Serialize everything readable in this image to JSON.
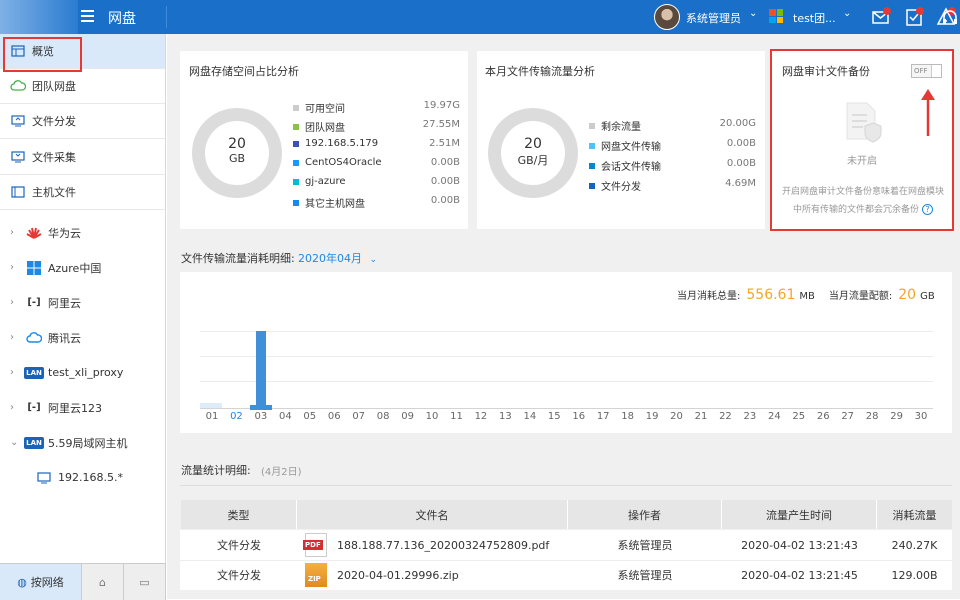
{
  "header": {
    "app_title": "网盘",
    "user_name": "系统管理员",
    "org_name": "test团...",
    "icons": [
      "menu-icon",
      "message-icon",
      "approval-icon",
      "alarm-icon",
      "headset-icon"
    ]
  },
  "sidebar": {
    "items": [
      {
        "label": "概览",
        "icon": "overview-icon"
      },
      {
        "label": "团队网盘",
        "icon": "cloud-icon"
      },
      {
        "label": "文件分发",
        "icon": "distribute-icon"
      },
      {
        "label": "文件采集",
        "icon": "collect-icon"
      },
      {
        "label": "主机文件",
        "icon": "host-icon"
      },
      {
        "label": "华为云",
        "icon": "huawei-icon"
      },
      {
        "label": "Azure中国",
        "icon": "windows-icon"
      },
      {
        "label": "阿里云",
        "icon": "aliyun-icon"
      },
      {
        "label": "腾讯云",
        "icon": "tencent-icon"
      },
      {
        "label": "test_xli_proxy",
        "icon": "lan-icon"
      },
      {
        "label": "阿里云123",
        "icon": "aliyun-icon"
      },
      {
        "label": "5.59局域网主机",
        "icon": "lan-icon"
      },
      {
        "label": "192.168.5.*",
        "icon": "monitor-icon"
      }
    ],
    "lan_badge": "LAN",
    "bottom_tabs": [
      {
        "label": "按网络",
        "icon": "globe-icon"
      },
      {
        "label": "",
        "icon": "tag-icon"
      },
      {
        "label": "",
        "icon": "folder-icon"
      }
    ]
  },
  "storage_card": {
    "title": "网盘存储空间占比分析",
    "center_value": "20",
    "center_unit": "GB",
    "legend": [
      {
        "label": "可用空间",
        "value": "19.97G",
        "color": "#cccccc"
      },
      {
        "label": "团队网盘",
        "value": "27.55M",
        "color": "#8bc34a"
      },
      {
        "label": "192.168.5.179",
        "value": "2.51M",
        "color": "#3f51b5"
      },
      {
        "label": "CentOS4Oracle",
        "value": "0.00B",
        "color": "#2196f3"
      },
      {
        "label": "gj-azure",
        "value": "0.00B",
        "color": "#00bcd4"
      },
      {
        "label": "其它主机网盘",
        "value": "0.00B",
        "color": "#1e88e5"
      }
    ]
  },
  "traffic_card": {
    "title": "本月文件传输流量分析",
    "center_value": "20",
    "center_unit": "GB/月",
    "legend": [
      {
        "label": "剩余流量",
        "value": "20.00G",
        "color": "#cccccc"
      },
      {
        "label": "网盘文件传输",
        "value": "0.00B",
        "color": "#4fc3f7"
      },
      {
        "label": "会话文件传输",
        "value": "0.00B",
        "color": "#0288d1"
      },
      {
        "label": "文件分发",
        "value": "4.69M",
        "color": "#1565c0"
      }
    ]
  },
  "backup_card": {
    "title": "网盘审计文件备份",
    "toggle_label": "OFF",
    "status": "未开启",
    "description": "开启网盘审计文件备份意味着在网盘模块中所有传输的文件都会冗余备份"
  },
  "detail": {
    "title": "文件传输流量消耗明细:",
    "month": "2020年04月",
    "total_label": "当月消耗总量:",
    "total_value": "556.61",
    "total_unit": "MB",
    "quota_label": "当月流量配额:",
    "quota_value": "20",
    "quota_unit": "GB"
  },
  "chart_data": {
    "type": "bar",
    "categories": [
      "01",
      "02",
      "03",
      "04",
      "05",
      "06",
      "07",
      "08",
      "09",
      "10",
      "11",
      "12",
      "13",
      "14",
      "15",
      "16",
      "17",
      "18",
      "19",
      "20",
      "21",
      "22",
      "23",
      "24",
      "25",
      "26",
      "27",
      "28",
      "29",
      "30"
    ],
    "values": [
      0,
      556.61,
      0,
      0,
      0,
      0,
      0,
      0,
      0,
      0,
      0,
      0,
      0,
      0,
      0,
      0,
      0,
      0,
      0,
      0,
      0,
      0,
      0,
      0,
      0,
      0,
      0,
      0,
      0,
      0
    ],
    "ylabel": "",
    "ylim": [
      0,
      650
    ],
    "grid": true
  },
  "stats": {
    "title": "流量统计明细:",
    "date": "(4月2日)",
    "columns": [
      "类型",
      "文件名",
      "操作者",
      "流量产生时间",
      "消耗流量"
    ],
    "rows": [
      {
        "type": "文件分发",
        "file_icon": "pdf-icon",
        "file_badge": "PDF",
        "filename": "188.188.77.136_20200324752809.pdf",
        "operator": "系统管理员",
        "time": "2020-04-02 13:21:43",
        "size": "240.27K"
      },
      {
        "type": "文件分发",
        "file_icon": "zip-icon",
        "file_badge": "ZIP",
        "filename": "2020-04-01.29996.zip",
        "operator": "系统管理员",
        "time": "2020-04-02 13:21:45",
        "size": "129.00B"
      }
    ]
  }
}
